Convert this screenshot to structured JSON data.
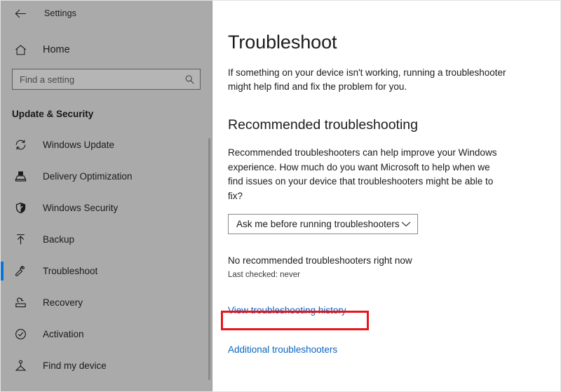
{
  "window": {
    "back_icon": "back-arrow-icon",
    "app_title": "Settings"
  },
  "sidebar": {
    "home": {
      "label": "Home",
      "icon": "home-icon"
    },
    "search": {
      "placeholder": "Find a setting",
      "value": "",
      "icon": "search-icon"
    },
    "section_title": "Update & Security",
    "accent_color": "#0a74d4",
    "items": [
      {
        "label": "Windows Update",
        "icon": "refresh-icon",
        "selected": false
      },
      {
        "label": "Delivery Optimization",
        "icon": "delivery-icon",
        "selected": false
      },
      {
        "label": "Windows Security",
        "icon": "shield-icon",
        "selected": false
      },
      {
        "label": "Backup",
        "icon": "upload-arrow-icon",
        "selected": false
      },
      {
        "label": "Troubleshoot",
        "icon": "wrench-icon",
        "selected": true
      },
      {
        "label": "Recovery",
        "icon": "recovery-icon",
        "selected": false
      },
      {
        "label": "Activation",
        "icon": "check-circle-icon",
        "selected": false
      },
      {
        "label": "Find my device",
        "icon": "find-device-icon",
        "selected": false
      }
    ]
  },
  "main": {
    "title": "Troubleshoot",
    "intro": "If something on your device isn't working, running a troubleshooter might help find and fix the problem for you.",
    "section_heading": "Recommended troubleshooting",
    "section_body": "Recommended troubleshooters can help improve your Windows experience. How much do you want Microsoft to help when we find issues on your device that troubleshooters might be able to fix?",
    "dropdown": {
      "value": "Ask me before running troubleshooters",
      "chevron_icon": "chevron-down-icon"
    },
    "status_main": "No recommended troubleshooters right now",
    "status_sub": "Last checked: never",
    "link_history": "View troubleshooting history",
    "link_additional": "Additional troubleshooters",
    "link_color": "#0a66c2",
    "highlight_color": "#e8131b"
  }
}
